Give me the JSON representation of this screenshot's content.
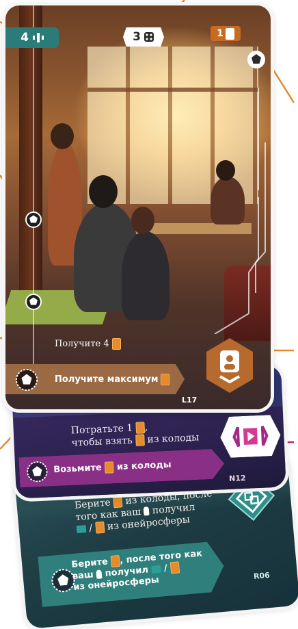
{
  "main_card": {
    "cost_chip": {
      "value": "4",
      "icon": "dream-sphere-icon",
      "color": "#2b7c78"
    },
    "dice_chip": {
      "value": "3",
      "icon": "dice-icon"
    },
    "card_chip": {
      "value": "1",
      "icon": "card-icon",
      "color": "#c86a22"
    },
    "reward_small_text": "Получите 4",
    "reward_banner_text": "Получите максимум",
    "symbol_icon": "person-badge-icon",
    "code": "L17",
    "accent_color": "#9b6a44"
  },
  "magenta_card": {
    "text_line_1": "Потратьте 1",
    "text_line_2": "чтобы взять",
    "text_line_2_suffix": "из колоды",
    "banner_prefix": "Возьмите",
    "banner_suffix": "из колоды",
    "symbol_icon": "play-bracket-icon",
    "code": "N12",
    "accent_color": "#8a2f86"
  },
  "teal_card": {
    "text_line_1_prefix": "Берите",
    "text_line_1_suffix": "из колоды, после",
    "text_line_2_prefix": "того как ваш",
    "text_line_2_suffix": "получил",
    "text_line_3": "из онейросферы",
    "text_line_3_sep": "/",
    "banner_line_1_prefix": "Берите",
    "banner_line_1_suffix": ", после того как",
    "banner_line_2_prefix": "ваш",
    "banner_line_2_mid": "получил",
    "banner_line_2_sep": "/",
    "banner_line_3": "из онейросферы",
    "symbol_icon": "link-diamond-icon",
    "code": "R06",
    "accent_color": "#2f7f7c"
  },
  "callout_colors": {
    "orange": "#e58a2d",
    "magenta": "#c0267a",
    "teal": "#2aa79a"
  }
}
